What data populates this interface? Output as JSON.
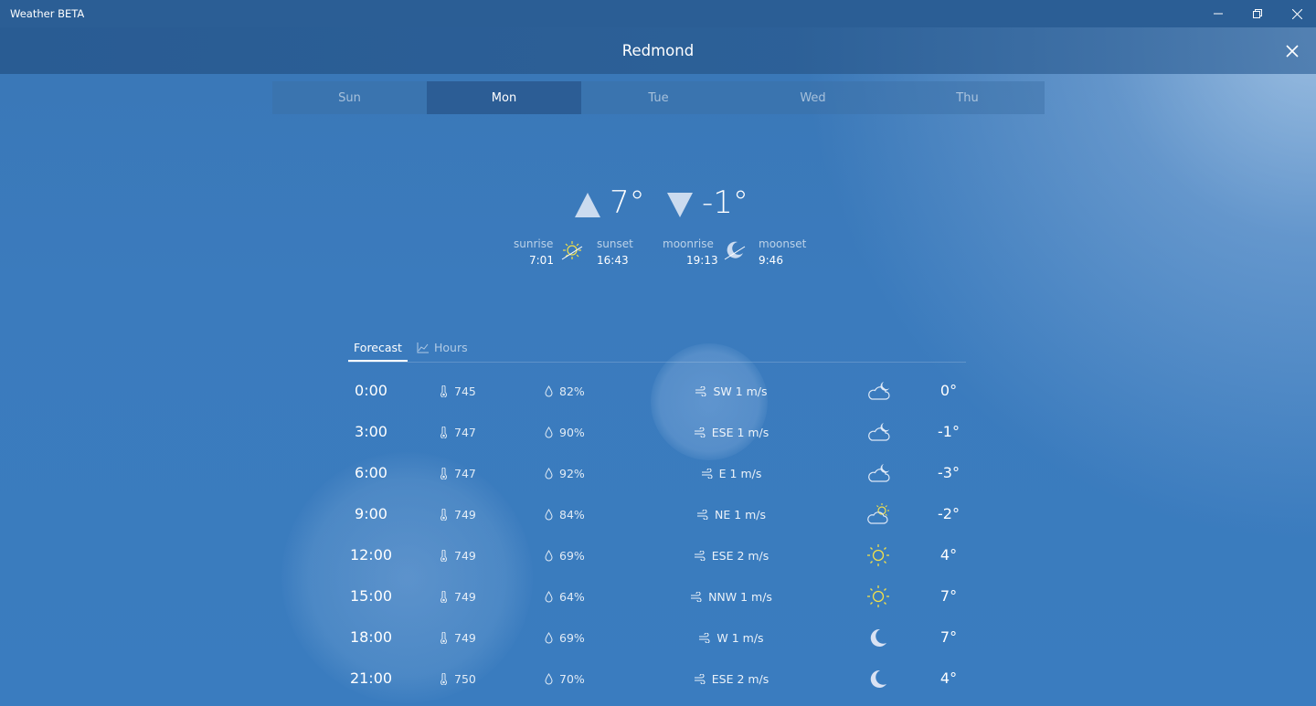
{
  "window": {
    "title": "Weather BETA"
  },
  "header": {
    "city": "Redmond"
  },
  "days": [
    {
      "label": "Sun",
      "active": false
    },
    {
      "label": "Mon",
      "active": true
    },
    {
      "label": "Tue",
      "active": false
    },
    {
      "label": "Wed",
      "active": false
    },
    {
      "label": "Thu",
      "active": false
    }
  ],
  "summary": {
    "high": "7°",
    "low": "-1°",
    "sunrise_label": "sunrise",
    "sunrise": "7:01",
    "sunset_label": "sunset",
    "sunset": "16:43",
    "moonrise_label": "moonrise",
    "moonrise": "19:13",
    "moonset_label": "moonset",
    "moonset": "9:46"
  },
  "forecast_tabs": {
    "forecast": "Forecast",
    "hours": "Hours",
    "active": "forecast"
  },
  "rows": [
    {
      "time": "0:00",
      "pressure": "745",
      "humidity": "82%",
      "wind": "SW 1 m/s",
      "icon": "cloudy-night-icon",
      "temp": "0°"
    },
    {
      "time": "3:00",
      "pressure": "747",
      "humidity": "90%",
      "wind": "ESE 1 m/s",
      "icon": "cloudy-night-icon",
      "temp": "-1°"
    },
    {
      "time": "6:00",
      "pressure": "747",
      "humidity": "92%",
      "wind": "E 1 m/s",
      "icon": "cloudy-night-icon",
      "temp": "-3°"
    },
    {
      "time": "9:00",
      "pressure": "749",
      "humidity": "84%",
      "wind": "NE 1 m/s",
      "icon": "partly-cloudy-icon",
      "temp": "-2°"
    },
    {
      "time": "12:00",
      "pressure": "749",
      "humidity": "69%",
      "wind": "ESE 2 m/s",
      "icon": "sun-icon",
      "temp": "4°"
    },
    {
      "time": "15:00",
      "pressure": "749",
      "humidity": "64%",
      "wind": "NNW 1 m/s",
      "icon": "sun-icon",
      "temp": "7°"
    },
    {
      "time": "18:00",
      "pressure": "749",
      "humidity": "69%",
      "wind": "W 1 m/s",
      "icon": "moon-icon",
      "temp": "7°"
    },
    {
      "time": "21:00",
      "pressure": "750",
      "humidity": "70%",
      "wind": "ESE 2 m/s",
      "icon": "moon-icon",
      "temp": "4°"
    }
  ],
  "colors": {
    "background": "#3a7cbf",
    "titlebar": "#2b5e95",
    "sun_icon": "#f2e04a"
  }
}
